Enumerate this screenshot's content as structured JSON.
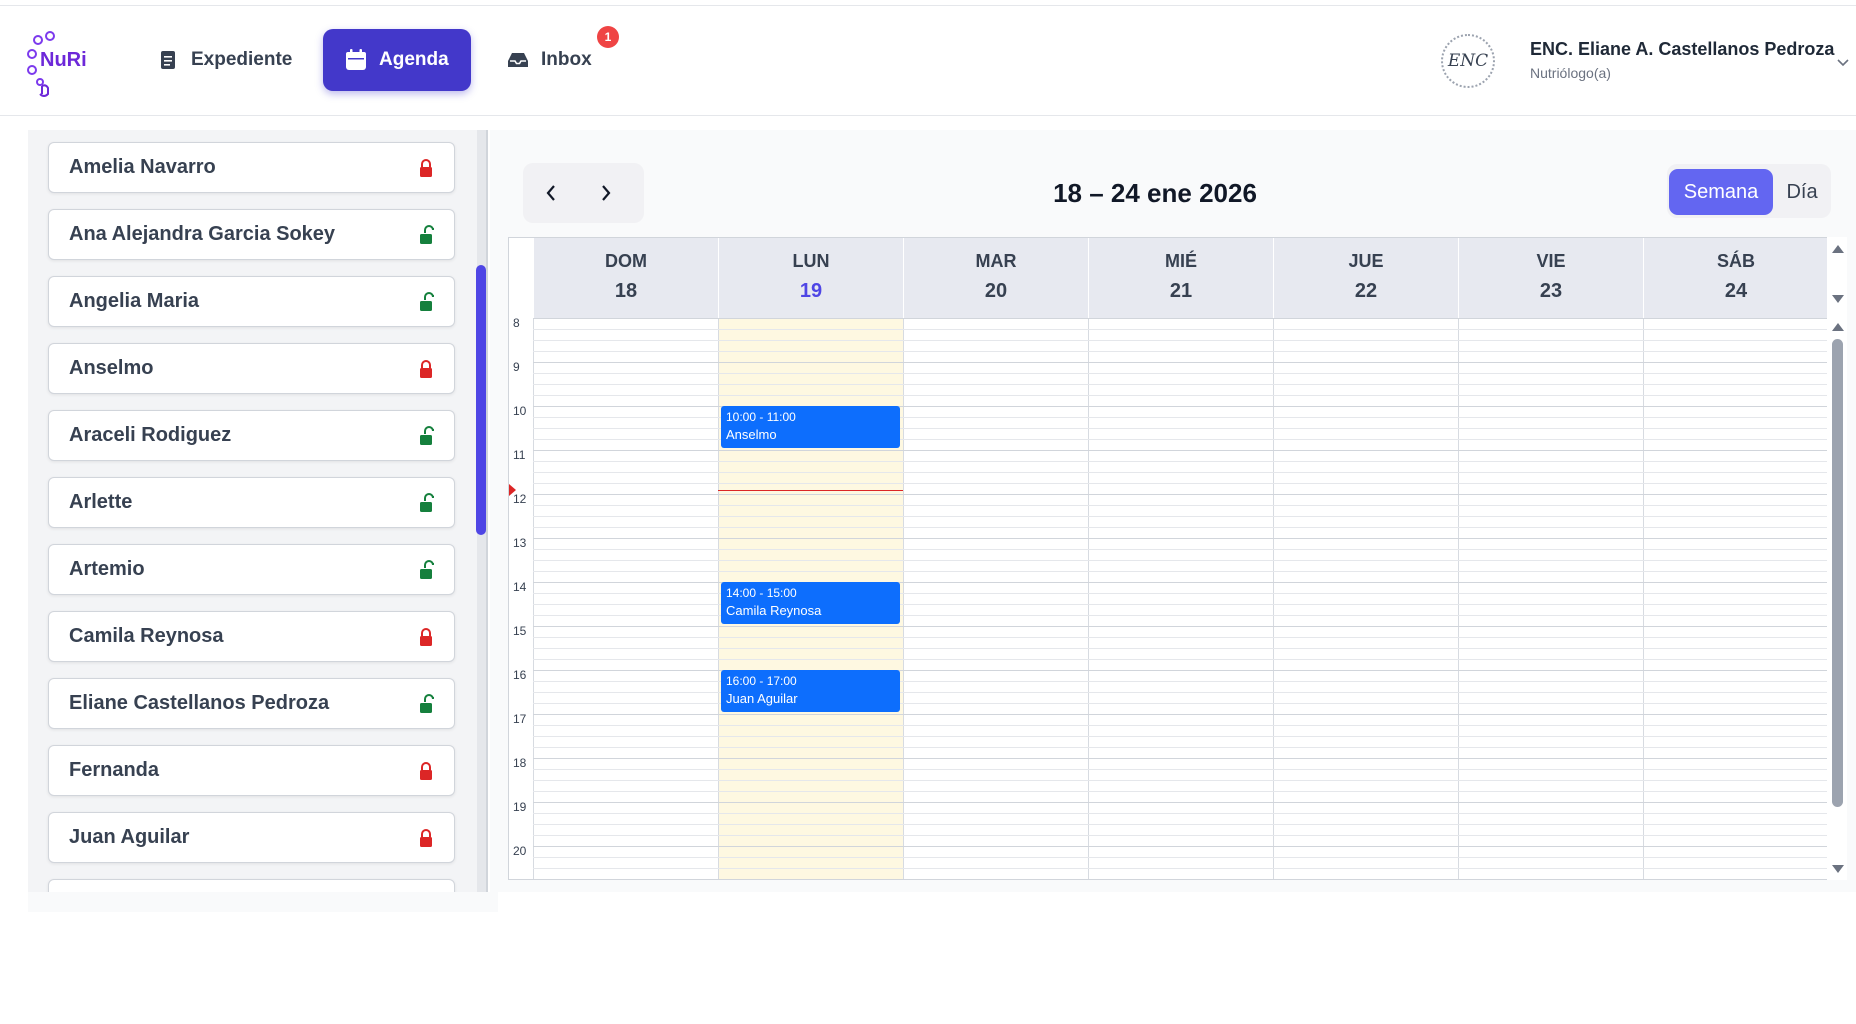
{
  "header": {
    "logo_text": "NuRi",
    "nav": [
      {
        "label": "Expediente",
        "icon": "document-icon"
      },
      {
        "label": "Agenda",
        "icon": "calendar-icon",
        "active": true
      },
      {
        "label": "Inbox",
        "icon": "inbox-icon"
      }
    ],
    "inbox_badge": "1",
    "user": {
      "avatar_initials": "ENC",
      "name": "ENC. Eliane A. Castellanos Pedroza",
      "role": "Nutriólogo(a)"
    }
  },
  "patients": [
    {
      "name": "Amelia Navarro",
      "lock": "locked"
    },
    {
      "name": "Ana Alejandra Garcia Sokey",
      "lock": "unlocked"
    },
    {
      "name": "Angelia Maria",
      "lock": "unlocked"
    },
    {
      "name": "Anselmo",
      "lock": "locked"
    },
    {
      "name": "Araceli Rodiguez",
      "lock": "unlocked"
    },
    {
      "name": "Arlette",
      "lock": "unlocked"
    },
    {
      "name": "Artemio",
      "lock": "unlocked"
    },
    {
      "name": "Camila Reynosa",
      "lock": "locked"
    },
    {
      "name": "Eliane Castellanos Pedroza",
      "lock": "unlocked"
    },
    {
      "name": "Fernanda",
      "lock": "locked"
    },
    {
      "name": "Juan Aguilar",
      "lock": "locked"
    }
  ],
  "colors": {
    "locked": "#dc2626",
    "unlocked": "#15803d",
    "accent": "#4338ca",
    "event": "#0d6efd",
    "today_column": "#fef8e1"
  },
  "calendar": {
    "range_title": "18 – 24 ene 2026",
    "view_options": {
      "week": "Semana",
      "day": "Día"
    },
    "active_view": "Semana",
    "days": [
      {
        "name": "DOM",
        "num": "18"
      },
      {
        "name": "LUN",
        "num": "19",
        "today": true
      },
      {
        "name": "MAR",
        "num": "20"
      },
      {
        "name": "MIÉ",
        "num": "21"
      },
      {
        "name": "JUE",
        "num": "22"
      },
      {
        "name": "VIE",
        "num": "23"
      },
      {
        "name": "SÁB",
        "num": "24"
      }
    ],
    "hours": [
      "8",
      "9",
      "10",
      "11",
      "12",
      "13",
      "14",
      "15",
      "16",
      "17",
      "18",
      "19",
      "20"
    ],
    "current_time_hour": 12.0,
    "events": [
      {
        "day": 1,
        "start": 10,
        "end": 11,
        "time": "10:00 - 11:00",
        "title": "Anselmo"
      },
      {
        "day": 1,
        "start": 14,
        "end": 15,
        "time": "14:00 - 15:00",
        "title": "Camila Reynosa"
      },
      {
        "day": 1,
        "start": 16,
        "end": 17,
        "time": "16:00 - 17:00",
        "title": "Juan Aguilar"
      }
    ]
  }
}
